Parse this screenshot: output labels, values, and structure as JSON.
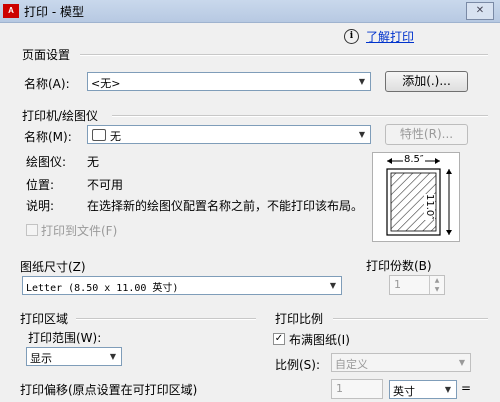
{
  "window": {
    "title": "打印 - 模型",
    "icon_label": "A",
    "close_glyph": "✕"
  },
  "help": {
    "info_glyph": "i",
    "link_label": "了解打印"
  },
  "page_setup": {
    "title": "页面设置",
    "name_label": "名称(A):",
    "name_value": "<无>",
    "add_button": "添加(.)..."
  },
  "printer": {
    "title": "打印机/绘图仪",
    "name_label": "名称(M):",
    "name_value": "无",
    "properties_button": "特性(R)...",
    "plotter_label": "绘图仪:",
    "plotter_value": "无",
    "location_label": "位置:",
    "location_value": "不可用",
    "desc_label": "说明:",
    "desc_value": "在选择新的绘图仪配置名称之前，不能打印该布局。",
    "print_to_file": "打印到文件(F)",
    "preview_width": "8.5″",
    "preview_height": "11.0″"
  },
  "paper_size": {
    "title": "图纸尺寸(Z)",
    "value": "Letter (8.50 x 11.00 英寸)"
  },
  "copies": {
    "title": "打印份数(B)",
    "value": "1"
  },
  "plot_area": {
    "title": "打印区域",
    "range_label": "打印范围(W):",
    "range_value": "显示"
  },
  "plot_scale": {
    "title": "打印比例",
    "fit_label": "布满图纸(I)",
    "fit_checked": true,
    "scale_label": "比例(S):",
    "scale_value": "自定义",
    "amount_value": "1",
    "unit_value": "英寸",
    "equals": "="
  },
  "plot_offset": {
    "title": "打印偏移(原点设置在可打印区域)"
  }
}
